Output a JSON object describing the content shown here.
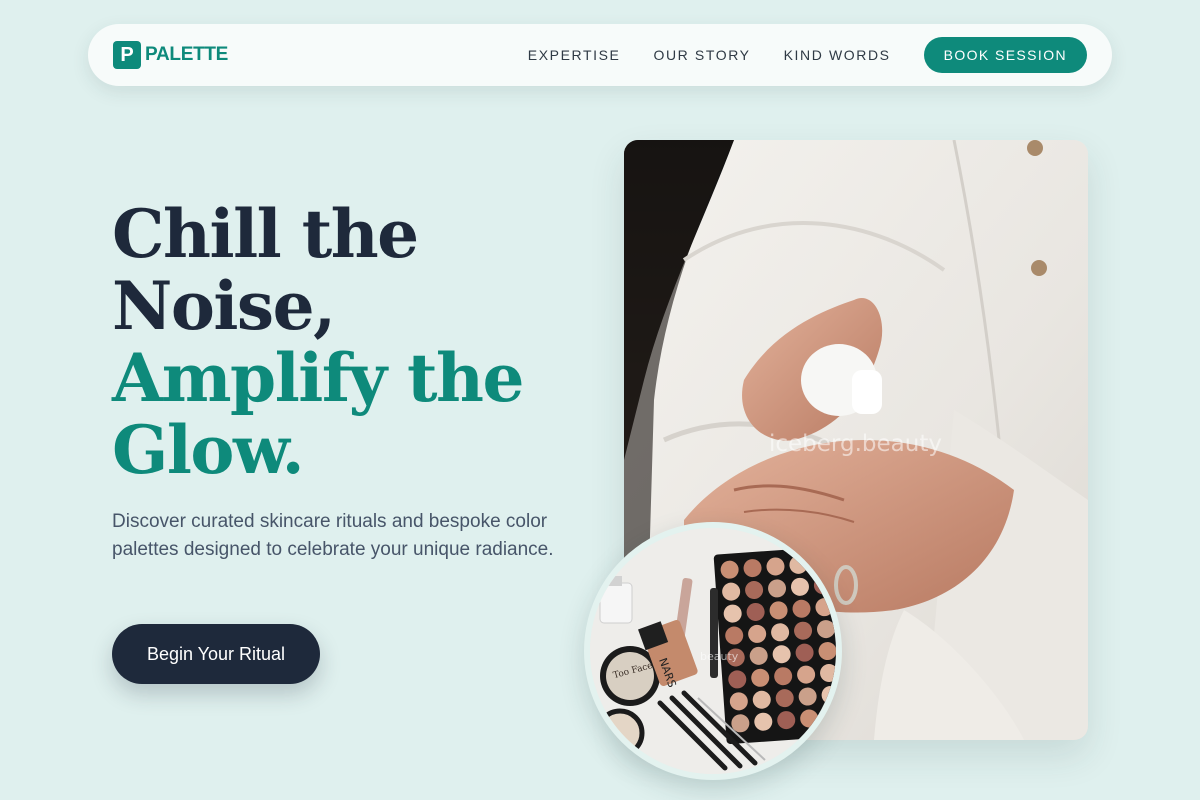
{
  "brand": {
    "mark": "P",
    "name": "PALETTE"
  },
  "nav": {
    "links": [
      "EXPERTISE",
      "OUR STORY",
      "KIND WORDS"
    ],
    "cta": "BOOK SESSION"
  },
  "hero": {
    "headline_line1": "Chill the",
    "headline_line2": "Noise,",
    "headline_line3": "Amplify the",
    "headline_line4": "Glow.",
    "description": "Discover curated skincare rituals and bespoke color palettes designed to celebrate your unique radiance.",
    "button": "Begin Your Ritual"
  },
  "images": {
    "main_watermark": "iceberg.beauty",
    "circle_watermark": "beauty",
    "circle_logo_text": "Too Faced",
    "circle_bottle_text": "NARS"
  },
  "colors": {
    "background": "#dff0ee",
    "accent": "#0e8a7b",
    "dark": "#1e293b"
  }
}
